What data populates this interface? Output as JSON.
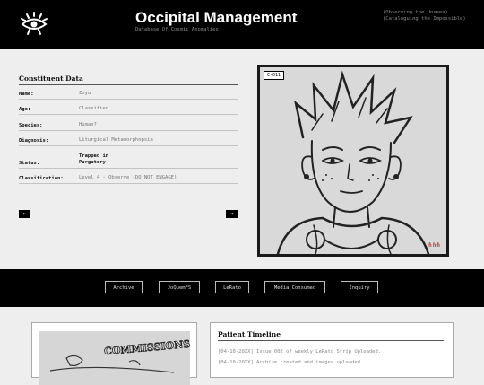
{
  "header": {
    "title": "Occipital Management",
    "subtitle": "Database Of Cosmic Anomalies",
    "taglines": [
      "(Observing the Unseen)",
      "(Cataloguing the Impossible)"
    ]
  },
  "constituent": {
    "heading": "Constituent Data",
    "fields": [
      {
        "label": "Name:",
        "value": "Zoyu"
      },
      {
        "label": "Age:",
        "value": "Classified"
      },
      {
        "label": "Species:",
        "value": "Human?"
      },
      {
        "label": "Diagnosis:",
        "value": "Liturgical Metamorphopsia"
      },
      {
        "label": "Status:",
        "value": "Trapped in Purgatory"
      },
      {
        "label": "Classification:",
        "value": "Level 4 - Observe (DO NOT ENGAGE)"
      }
    ],
    "prev_label": "←",
    "next_label": "→"
  },
  "portrait": {
    "case_id": "C-011",
    "signature": "ɦɦɦ"
  },
  "nav": {
    "items": [
      "Archive",
      "JoQuemFS",
      "LeRato",
      "Media Consumed",
      "Inquiry"
    ]
  },
  "commissions": {
    "image_text": "COMMISSIONS"
  },
  "timeline": {
    "heading": "Patient Timeline",
    "entries": [
      "[04-10-20XX] Issue 002 of weekly LeRato Strip Uploaded.",
      "[04-10-20XX] Archive created and images uploaded."
    ]
  }
}
